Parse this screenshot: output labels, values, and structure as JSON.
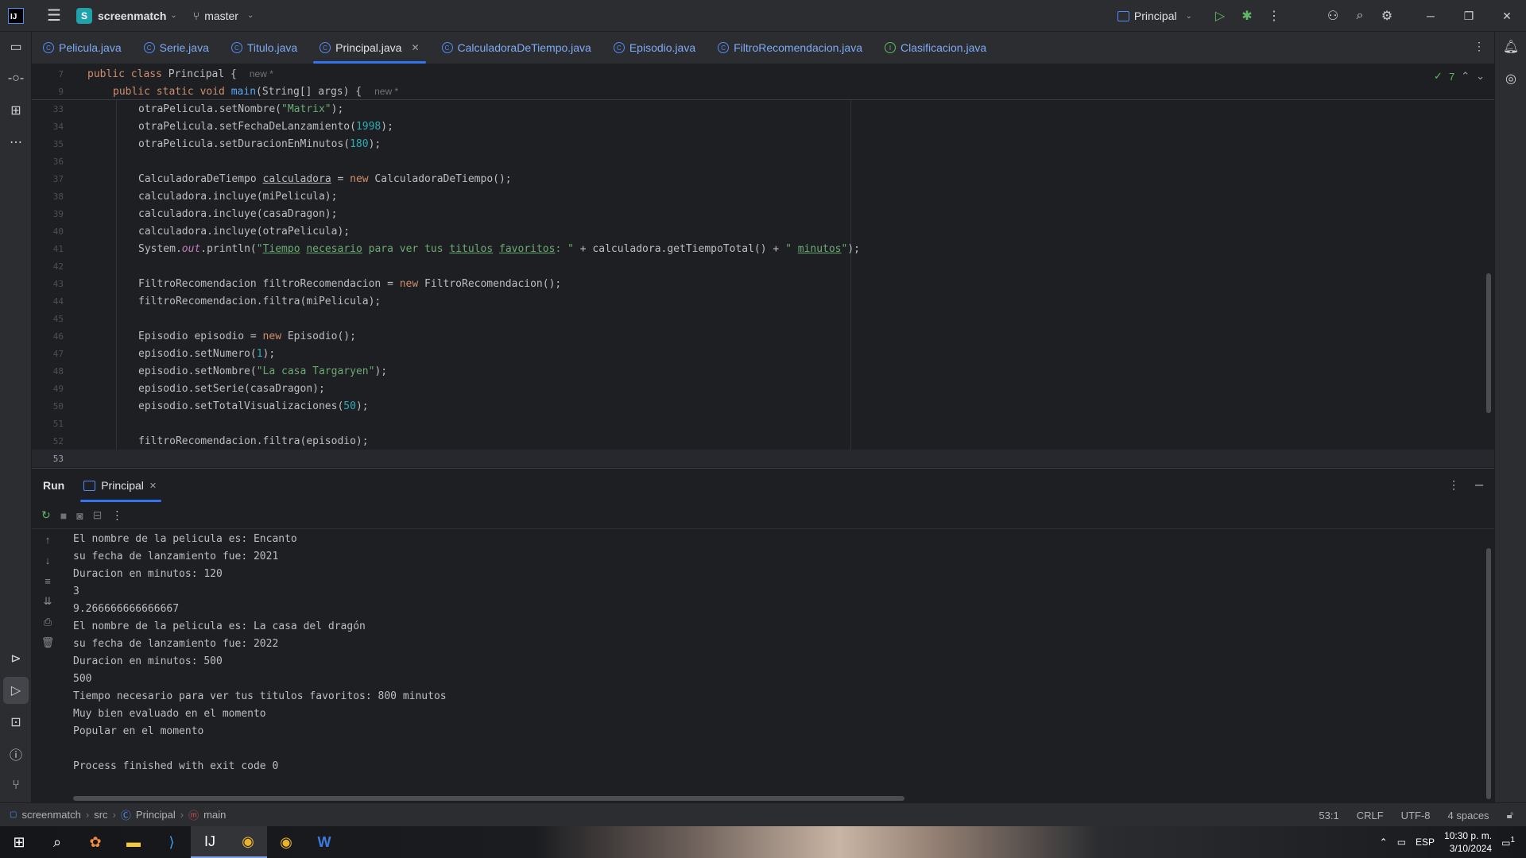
{
  "titlebar": {
    "project_initial": "S",
    "project_name": "screenmatch",
    "branch": "master",
    "run_config": "Principal"
  },
  "tabs": [
    {
      "label": "Pelicula.java",
      "active": false
    },
    {
      "label": "Serie.java",
      "active": false
    },
    {
      "label": "Titulo.java",
      "active": false
    },
    {
      "label": "Principal.java",
      "active": true
    },
    {
      "label": "CalculadoraDeTiempo.java",
      "active": false
    },
    {
      "label": "Episodio.java",
      "active": false
    },
    {
      "label": "FiltroRecomendacion.java",
      "active": false
    },
    {
      "label": "Clasificacion.java",
      "active": false
    }
  ],
  "editor": {
    "inspection_count": "7",
    "sticky": [
      {
        "num": "7",
        "hint": "new *"
      },
      {
        "num": "9",
        "hint": "new *"
      }
    ],
    "line_numbers": [
      "33",
      "34",
      "35",
      "36",
      "37",
      "38",
      "39",
      "40",
      "41",
      "42",
      "43",
      "44",
      "45",
      "46",
      "47",
      "48",
      "49",
      "50",
      "51",
      "52",
      "53"
    ],
    "strings": {
      "matrix": "\"Matrix\"",
      "year": "1998",
      "duration": "180",
      "episode_num": "1",
      "episode_name": "\"La casa Targaryen\"",
      "views": "50"
    }
  },
  "run_panel": {
    "title": "Run",
    "tab": "Principal",
    "output": [
      "El nombre de la pelicula es: Encanto",
      "su fecha de lanzamiento fue: 2021",
      "Duracion en minutos: 120",
      "3",
      "9.266666666666667",
      "El nombre de la pelicula es: La casa del dragón",
      "su fecha de lanzamiento fue: 2022",
      "Duracion en minutos: 500",
      "500",
      "Tiempo necesario para ver tus titulos favoritos: 800 minutos",
      "Muy bien evaluado en el momento",
      "Popular en el momento",
      "",
      "Process finished with exit code 0"
    ]
  },
  "statusbar": {
    "crumbs": [
      "screenmatch",
      "src",
      "Principal",
      "main"
    ],
    "position": "53:1",
    "line_sep": "CRLF",
    "encoding": "UTF-8",
    "indent": "4 spaces"
  },
  "taskbar": {
    "lang": "ESP",
    "time": "10:30 p. m.",
    "date": "3/10/2024",
    "notif_count": "1"
  }
}
